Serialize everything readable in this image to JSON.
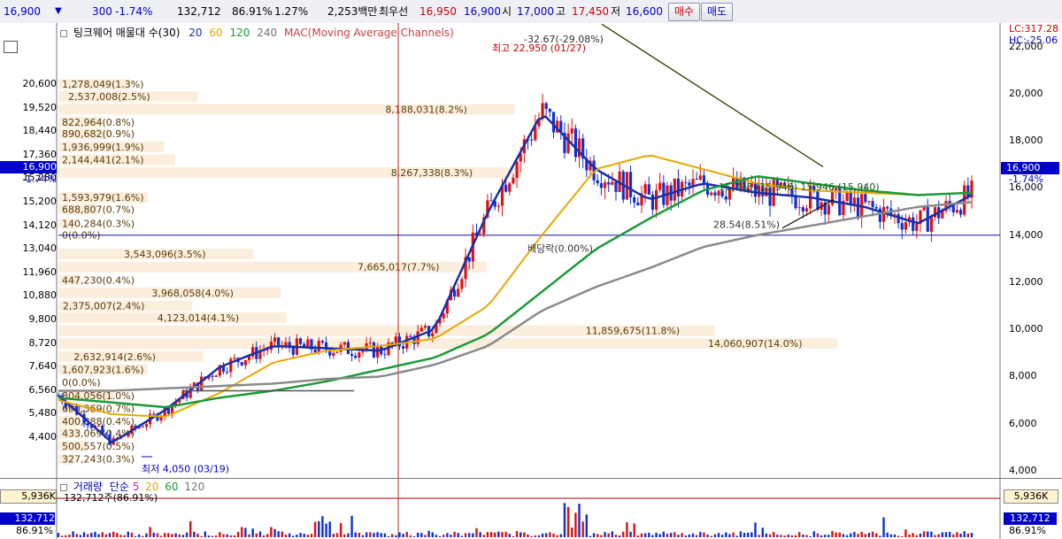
{
  "toolbar": {
    "price": "16,900",
    "change": "300",
    "change_pct": "-1.74%",
    "volume": "132,712",
    "ratio1": "86.91%",
    "ratio2": "1.27%",
    "amount": "2,253백만",
    "best_label": "최우선",
    "best_ask": "16,950",
    "best_bid": "16,900",
    "open_label": "시",
    "open": "17,000",
    "high_label": "고",
    "high": "17,450",
    "low_label": "저",
    "low": "16,600",
    "buy_label": "매수",
    "sell_label": "매도"
  },
  "header": {
    "indicator": "팅크웨어 매물대 수(30)",
    "ma_periods": [
      "20",
      "60",
      "120",
      "240"
    ],
    "ma_colors": [
      "#1a2fa8",
      "#e6a800",
      "#1a9a38",
      "#8a8a8a"
    ],
    "mac_label": "MAC(Moving Average Channels)",
    "lc": "LC:317.28",
    "hc": "HC:-25.06"
  },
  "left_axis": [
    "20,600",
    "19,520",
    "18,440",
    "17,360",
    "15,280",
    "15,200",
    "14,120",
    "13,040",
    "11,960",
    "10,880",
    "9,800",
    "8,720",
    "7,640",
    "6,560",
    "5,480",
    "4,400"
  ],
  "right_axis": [
    "22,000",
    "20,000",
    "18,000",
    "16,000",
    "14,000",
    "12,000",
    "10,000",
    "8,000",
    "6,000",
    "4,000"
  ],
  "current_price": {
    "value": "16,900",
    "change": "-1.74%"
  },
  "right_badge": {
    "value": "16,900",
    "change": "-1.74%"
  },
  "annotations": {
    "high": "최고 22,950 (01/27)",
    "low": "최저 4,050 (03/19)",
    "tri_top": "-32.67(-29.08%)",
    "tri_bottom": "28.54(8.51%)",
    "dividend": "배당락(0.00%)",
    "mid": "15,795 (15,946) 15,946 (15,940)"
  },
  "chart_data": {
    "type": "line",
    "title": "팅크웨어 매물대 수(30)",
    "price_range": [
      3700,
      23000
    ],
    "series": [
      {
        "name": "20",
        "values": [
          7200,
          5200,
          6600,
          8400,
          9300,
          9200,
          9100,
          10000,
          15000,
          19200,
          16800,
          15500,
          16200,
          15800,
          15600,
          15200,
          14500,
          15700
        ]
      },
      {
        "name": "60",
        "values": [
          7000,
          6400,
          6300,
          7300,
          8600,
          9100,
          9300,
          9600,
          11000,
          14000,
          16800,
          17400,
          16800,
          16200,
          15900,
          15800,
          15700,
          15800
        ]
      },
      {
        "name": "120",
        "values": [
          7100,
          6900,
          6700,
          7100,
          7400,
          7800,
          8300,
          8800,
          9800,
          11600,
          13400,
          14700,
          15900,
          16500,
          16200,
          15900,
          15700,
          15800
        ]
      },
      {
        "name": "240",
        "values": [
          7400,
          7400,
          7500,
          7600,
          7700,
          7900,
          8000,
          8500,
          9300,
          10800,
          11800,
          12600,
          13500,
          14000,
          14400,
          14800,
          15200,
          15400
        ]
      }
    ],
    "volume_profile": [
      {
        "label": "1,278,049(1.3%)",
        "price": 20400
      },
      {
        "label": "2,537,008(2.5%)",
        "price": 19880
      },
      {
        "label": "8,188,031(8.2%)",
        "price": 19340
      },
      {
        "label": "822,964(0.8%)",
        "price": 18800
      },
      {
        "label": "890,682(0.9%)",
        "price": 18300
      },
      {
        "label": "1,936,999(1.9%)",
        "price": 17750
      },
      {
        "label": "2,144,441(2.1%)",
        "price": 17200
      },
      {
        "label": "8,267,338(8.3%)",
        "price": 16650
      },
      {
        "label": "1,593,979(1.6%)",
        "price": 15600
      },
      {
        "label": "688,807(0.7%)",
        "price": 15100
      },
      {
        "label": "140,284(0.3%)",
        "price": 14500
      },
      {
        "label": "0(0.0%)",
        "price": 14000
      },
      {
        "label": "3,543,096(3.5%)",
        "price": 13200
      },
      {
        "label": "7,665,017(7.7%)",
        "price": 12650
      },
      {
        "label": "447,230(0.4%)",
        "price": 12100
      },
      {
        "label": "3,968,058(4.0%)",
        "price": 11550
      },
      {
        "label": "2,375,007(2.4%)",
        "price": 11000
      },
      {
        "label": "4,123,014(4.1%)",
        "price": 10500
      },
      {
        "label": "11,859,675(11.8%)",
        "price": 9950
      },
      {
        "label": "14,060,907(14.0%)",
        "price": 9400
      },
      {
        "label": "2,632,914(2.6%)",
        "price": 8850
      },
      {
        "label": "1,607,923(1.6%)",
        "price": 8300
      },
      {
        "label": "0(0.0%)",
        "price": 7750
      },
      {
        "label": "804,056(1.0%)",
        "price": 7200
      },
      {
        "label": "690,369(0.7%)",
        "price": 6650
      },
      {
        "label": "400,888(0.4%)",
        "price": 6100
      },
      {
        "label": "433,069(0.4%)",
        "price": 5600
      },
      {
        "label": "500,557(0.5%)",
        "price": 5050
      },
      {
        "label": "327,243(0.3%)",
        "price": 4500
      }
    ],
    "horizontal_line": 14000,
    "ylim": [
      3700,
      23000
    ]
  },
  "volume_panel": {
    "title": "거래량",
    "ma_label": "단순",
    "periods": [
      "5",
      "20",
      "60",
      "120"
    ],
    "period_colors": [
      "#c020c0",
      "#e6a800",
      "#1a9a38",
      "#8a8a8a"
    ],
    "volume_text": "132,712주(86.91%)",
    "left_top": "5,936K",
    "left_current": "132,712",
    "left_pct": "86.91%",
    "right_top": "5,936K",
    "right_current": "132,712",
    "right_pct": "86.91%"
  }
}
